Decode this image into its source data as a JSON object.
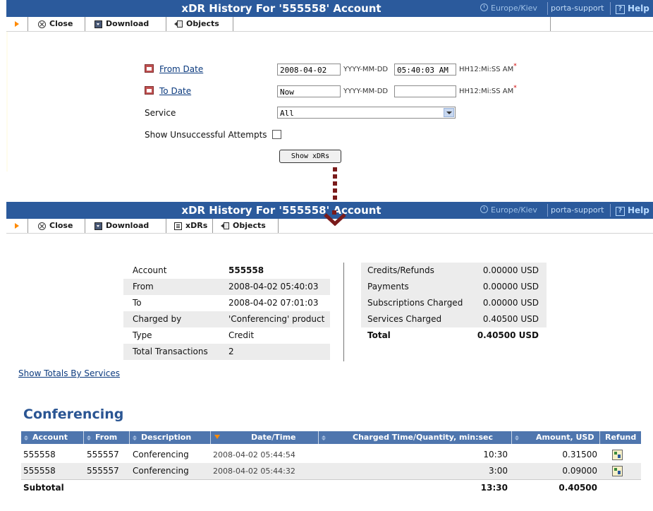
{
  "header": {
    "title1": "xDR History For '555558' Account",
    "title2": "xDR History For '555558' Account",
    "timezone": "Europe/Kiev",
    "user": "porta-support",
    "help": "Help"
  },
  "toolbar1": {
    "close": "Close",
    "download": "Download",
    "objects": "Objects"
  },
  "toolbar2": {
    "close": "Close",
    "download": "Download",
    "xdrs": "xDRs",
    "objects": "Objects"
  },
  "form": {
    "from_label": "From Date",
    "from_date": "2008-04-02",
    "from_time": "05:40:03 AM",
    "to_label": "To Date",
    "to_date": "Now",
    "to_time": "",
    "date_fmt": "YYYY-MM-DD",
    "time_fmt": "HH12:Mi:SS AM",
    "required": "*",
    "service_label": "Service",
    "service_value": "All",
    "unsuccessful_label": "Show Unsuccessful Attempts",
    "unsuccessful_checked": false,
    "submit": "Show xDRs"
  },
  "summary_left": [
    {
      "label": "Account",
      "value": "555558"
    },
    {
      "label": "From",
      "value": "2008-04-02 05:40:03"
    },
    {
      "label": "To",
      "value": "2008-04-02 07:01:03"
    },
    {
      "label": "Charged by",
      "value": "'Conferencing' product"
    },
    {
      "label": "Type",
      "value": "Credit"
    },
    {
      "label": "Total Transactions",
      "value": "2"
    }
  ],
  "summary_right": [
    {
      "label": "Credits/Refunds",
      "value": "0.00000 USD"
    },
    {
      "label": "Payments",
      "value": "0.00000 USD"
    },
    {
      "label": "Subscriptions Charged",
      "value": "0.00000 USD"
    },
    {
      "label": "Services Charged",
      "value": "0.40500 USD"
    },
    {
      "label": "Total",
      "value": "0.40500 USD"
    }
  ],
  "show_totals_link": "Show Totals By Services",
  "section_title": "Conferencing",
  "table": {
    "columns": [
      "Account",
      "From",
      "Description",
      "Date/Time",
      "Charged Time/Quantity, min:sec",
      "Amount, USD",
      "Refund"
    ],
    "rows": [
      {
        "account": "555558",
        "from": "555557",
        "description": "Conferencing",
        "datetime": "2008-04-02 05:44:54",
        "charged": "10:30",
        "amount": "0.31500"
      },
      {
        "account": "555558",
        "from": "555557",
        "description": "Conferencing",
        "datetime": "2008-04-02 05:44:32",
        "charged": "3:00",
        "amount": "0.09000"
      }
    ],
    "subtotal": {
      "label": "Subtotal",
      "charged": "13:30",
      "amount": "0.40500"
    }
  },
  "colors": {
    "header_bg": "#2b5a9c",
    "table_header_bg": "#4f76ae",
    "accent_orange": "#ff8a00",
    "title_blue": "#2a5593",
    "connector": "#7a1b1b"
  }
}
